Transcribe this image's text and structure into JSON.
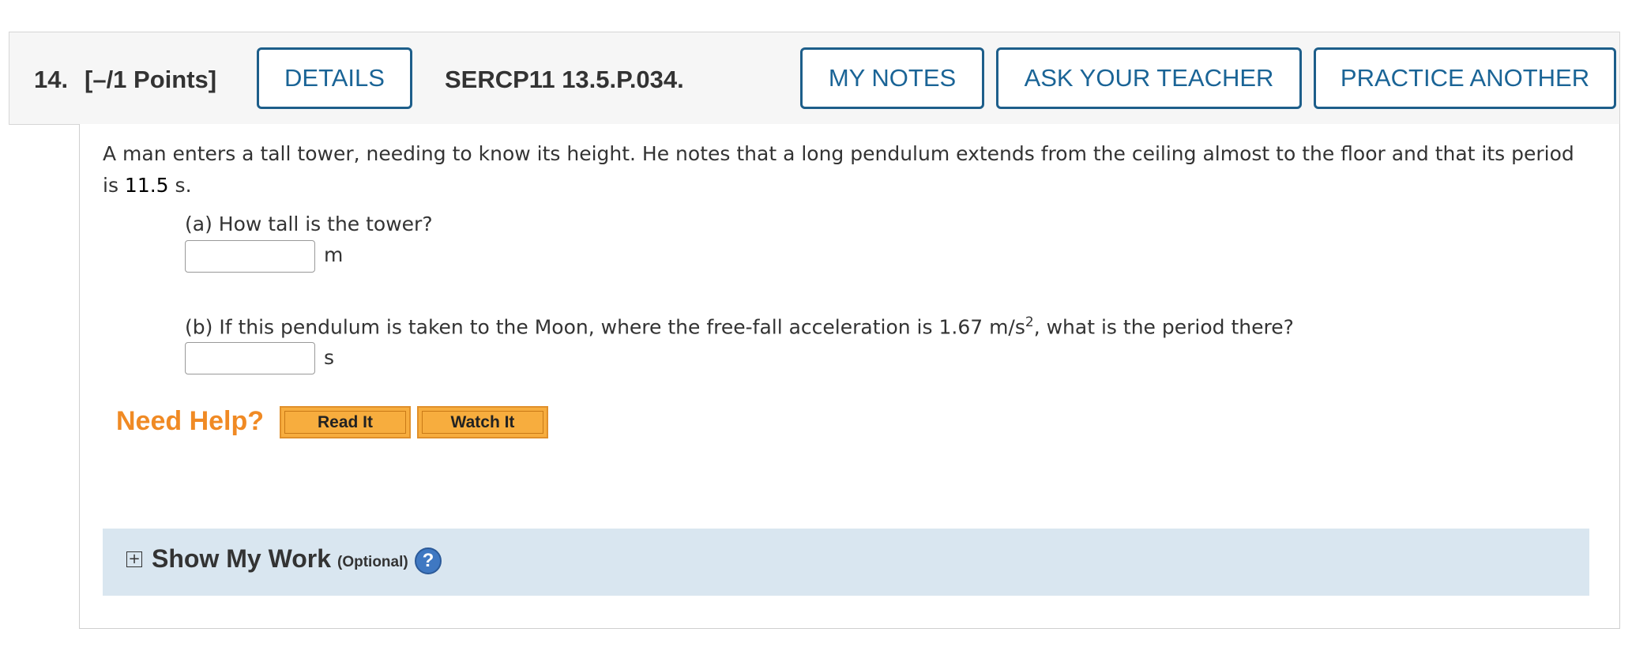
{
  "header": {
    "question_number": "14.",
    "points": "[–/1 Points]",
    "details_label": "DETAILS",
    "problem_code": "SERCP11 13.5.P.034.",
    "my_notes_label": "MY NOTES",
    "ask_teacher_label": "ASK YOUR TEACHER",
    "practice_another_label": "PRACTICE ANOTHER"
  },
  "question": {
    "text_before": "A man enters a tall tower, needing to know its height. He notes that a long pendulum extends from the ceiling almost to the floor and that its period is ",
    "period_value": "11.5",
    "text_after": " s.",
    "part_a": {
      "prompt": "(a) How tall is the tower?",
      "unit": "m",
      "answer_value": ""
    },
    "part_b": {
      "prompt_before": "(b) If this pendulum is taken to the Moon, where the free-fall acceleration is 1.67 m/s",
      "prompt_sup": "2",
      "prompt_after": ", what is the period there?",
      "unit": "s",
      "answer_value": ""
    }
  },
  "help": {
    "label": "Need Help?",
    "read_it_label": "Read It",
    "watch_it_label": "Watch It"
  },
  "show_my_work": {
    "toggle_symbol": "+",
    "title": "Show My Work",
    "optional_label": "(Optional)",
    "help_symbol": "?"
  }
}
